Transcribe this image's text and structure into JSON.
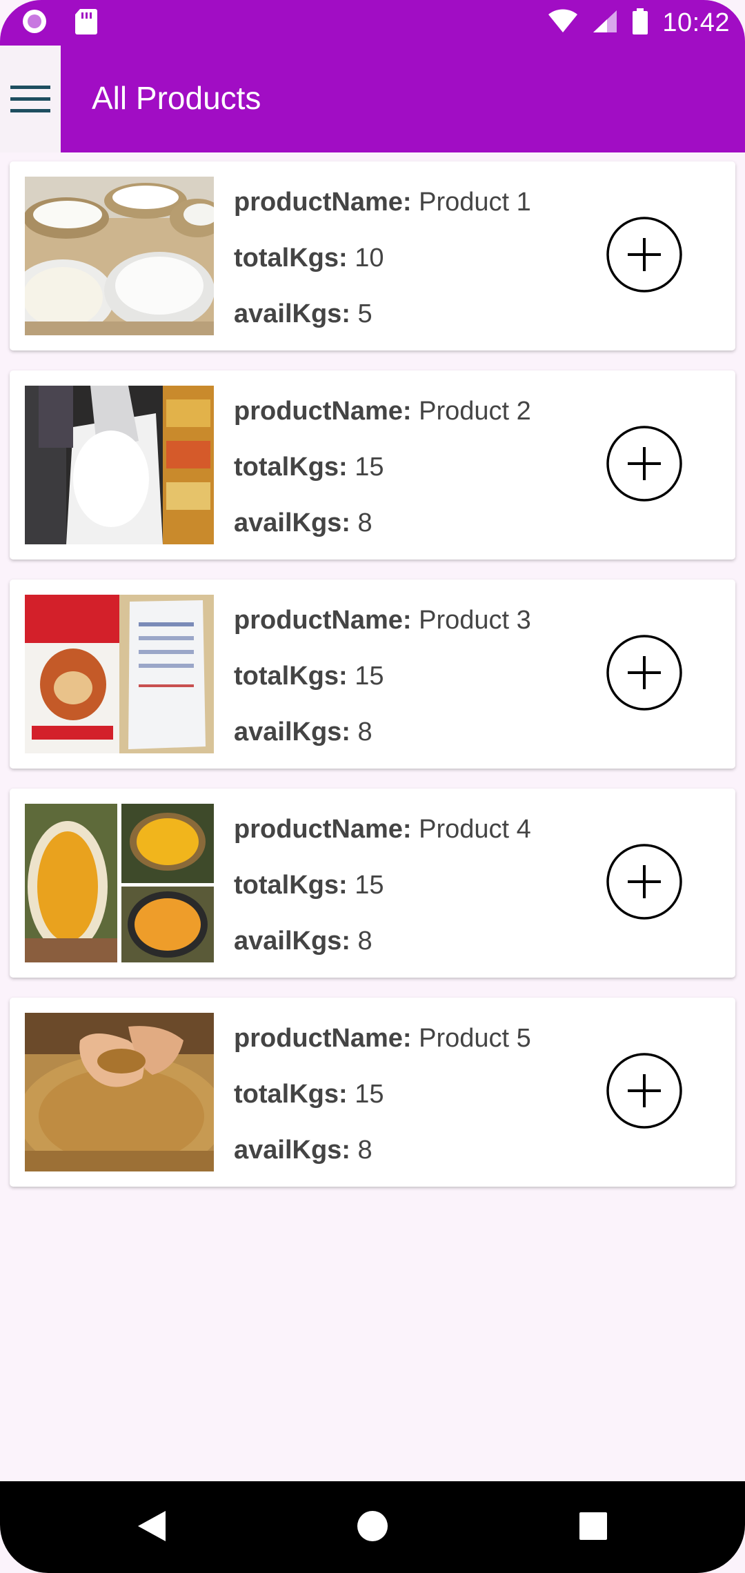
{
  "status_bar": {
    "time": "10:42",
    "left_icons": [
      "notification-circle-icon",
      "sd-card-icon"
    ],
    "right_icons": [
      "wifi-icon",
      "cellular-signal-icon",
      "battery-icon"
    ]
  },
  "app_bar": {
    "title": "All Products",
    "menu_icon": "hamburger-menu-icon",
    "background": "#A10DC4"
  },
  "labels": {
    "product_name": "productName:",
    "total_kgs": "totalKgs:",
    "avail_kgs": "availKgs:"
  },
  "products": [
    {
      "name": "Product 1",
      "total_kgs": "10",
      "avail_kgs": "5",
      "image": "rice-sacks-image"
    },
    {
      "name": "Product 2",
      "total_kgs": "15",
      "avail_kgs": "8",
      "image": "rice-bag-pouring-image"
    },
    {
      "name": "Product 3",
      "total_kgs": "15",
      "avail_kgs": "8",
      "image": "packaged-product-image"
    },
    {
      "name": "Product 4",
      "total_kgs": "15",
      "avail_kgs": "8",
      "image": "yellow-lentils-image"
    },
    {
      "name": "Product 5",
      "total_kgs": "15",
      "avail_kgs": "8",
      "image": "wheat-grain-hands-image"
    }
  ],
  "add_icon": "add-circle-icon",
  "nav_bar": {
    "icons": [
      "back-icon",
      "home-icon",
      "recents-icon"
    ]
  }
}
